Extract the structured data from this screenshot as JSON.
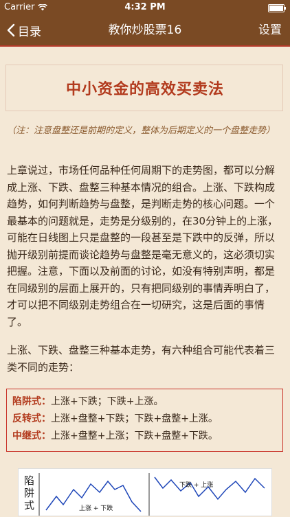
{
  "status": {
    "carrier": "Carrier",
    "time": "4:32 PM"
  },
  "nav": {
    "back_label": "目录",
    "title": "教你炒股票16",
    "settings_label": "设置"
  },
  "article": {
    "title": "中小资金的高效买卖法",
    "note": "（注：注意盘整还是前期的定义，整体为后期定义的一个盘整走势）",
    "para1": "上章说过，市场任何品种任何周期下的走势图，都可以分解成上涨、下跌、盘整三种基本情况的组合。上涨、下跌构成趋势，如何判断趋势与盘整，是判断走势的核心问题。一个最基本的问题就是，走势是分级别的，在30分钟上的上涨，可能在日线图上只是盘整的一段甚至是下跌中的反弹，所以抛开级别前提而谈论趋势与盘整是毫无意义的，这必须切实把握。注意，下面以及前面的讨论，如没有特别声明，都是在同级别的层面上展开的，只有把同级别的事情弄明白了，才可以把不同级别走势组合在一切研究，这是后面的事情了。",
    "para2": "上涨、下跌、盘整三种基本走势，有六种组合可能代表着三类不同的走势：",
    "box": [
      {
        "term": "陷阱式：",
        "text": "上涨+下跌；下跌+上涨。"
      },
      {
        "term": "反转式：",
        "text": "上涨+盘整+下跌；下跌+盘整+上涨。"
      },
      {
        "term": "中继式：",
        "text": "上涨+盘整+上涨；下跌+盘整+下跌。"
      }
    ],
    "diagram": {
      "side_label": "陷阱式",
      "label1": "上涨 + 下跌",
      "label2": "下跌 + 上涨"
    }
  }
}
